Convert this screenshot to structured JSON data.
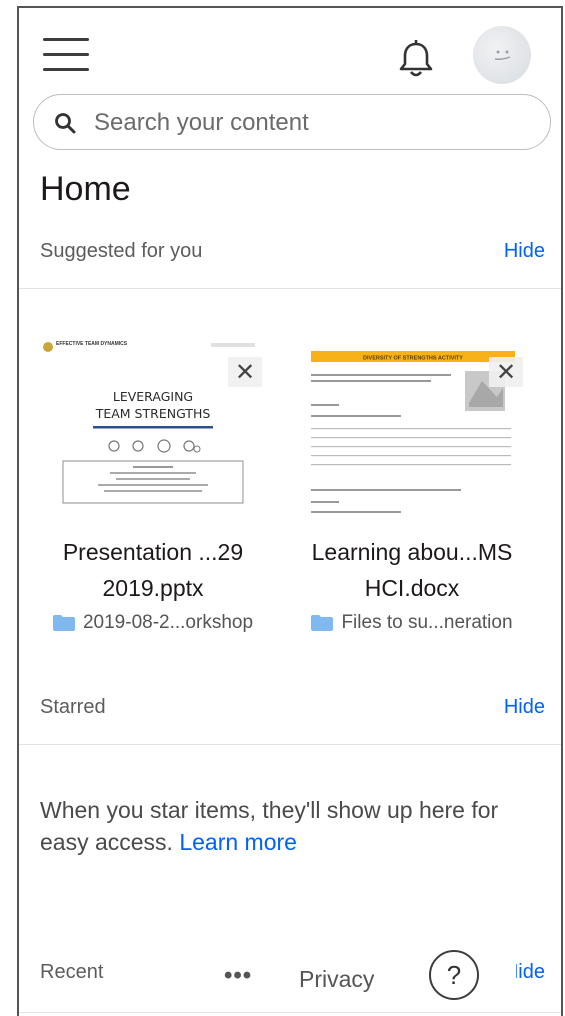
{
  "search": {
    "placeholder": "Search your content"
  },
  "page_title": "Home",
  "sections": {
    "suggested": {
      "label": "Suggested for you",
      "hide_label": "Hide"
    },
    "starred": {
      "label": "Starred",
      "hide_label": "Hide"
    },
    "recent": {
      "label": "Recent",
      "hide_label": "Hide"
    }
  },
  "suggested_items": [
    {
      "name_line1": "Presentation ...29",
      "name_line2": "2019.pptx",
      "folder": "2019-08-2...orkshop",
      "thumb": {
        "logo_text": "EFFECTIVE TEAM DYNAMICS",
        "title_line1": "LEVERAGING",
        "title_line2": "TEAM STRENGTHS"
      }
    },
    {
      "name_line1": "Learning abou...MS",
      "name_line2": "HCI.docx",
      "folder": "Files to su...neration",
      "thumb": {
        "header_text": "DIVERSITY OF STRENGTHS ACTIVITY"
      }
    }
  ],
  "starred_message": {
    "text": "When you star items, they'll show up here for easy access.",
    "link": "Learn more"
  },
  "footer": {
    "more": "•••",
    "privacy": "Privacy",
    "help": "?"
  },
  "colors": {
    "accent": "#0061fe",
    "folder": "#80b8f0",
    "doc_header": "#f7b21a"
  }
}
